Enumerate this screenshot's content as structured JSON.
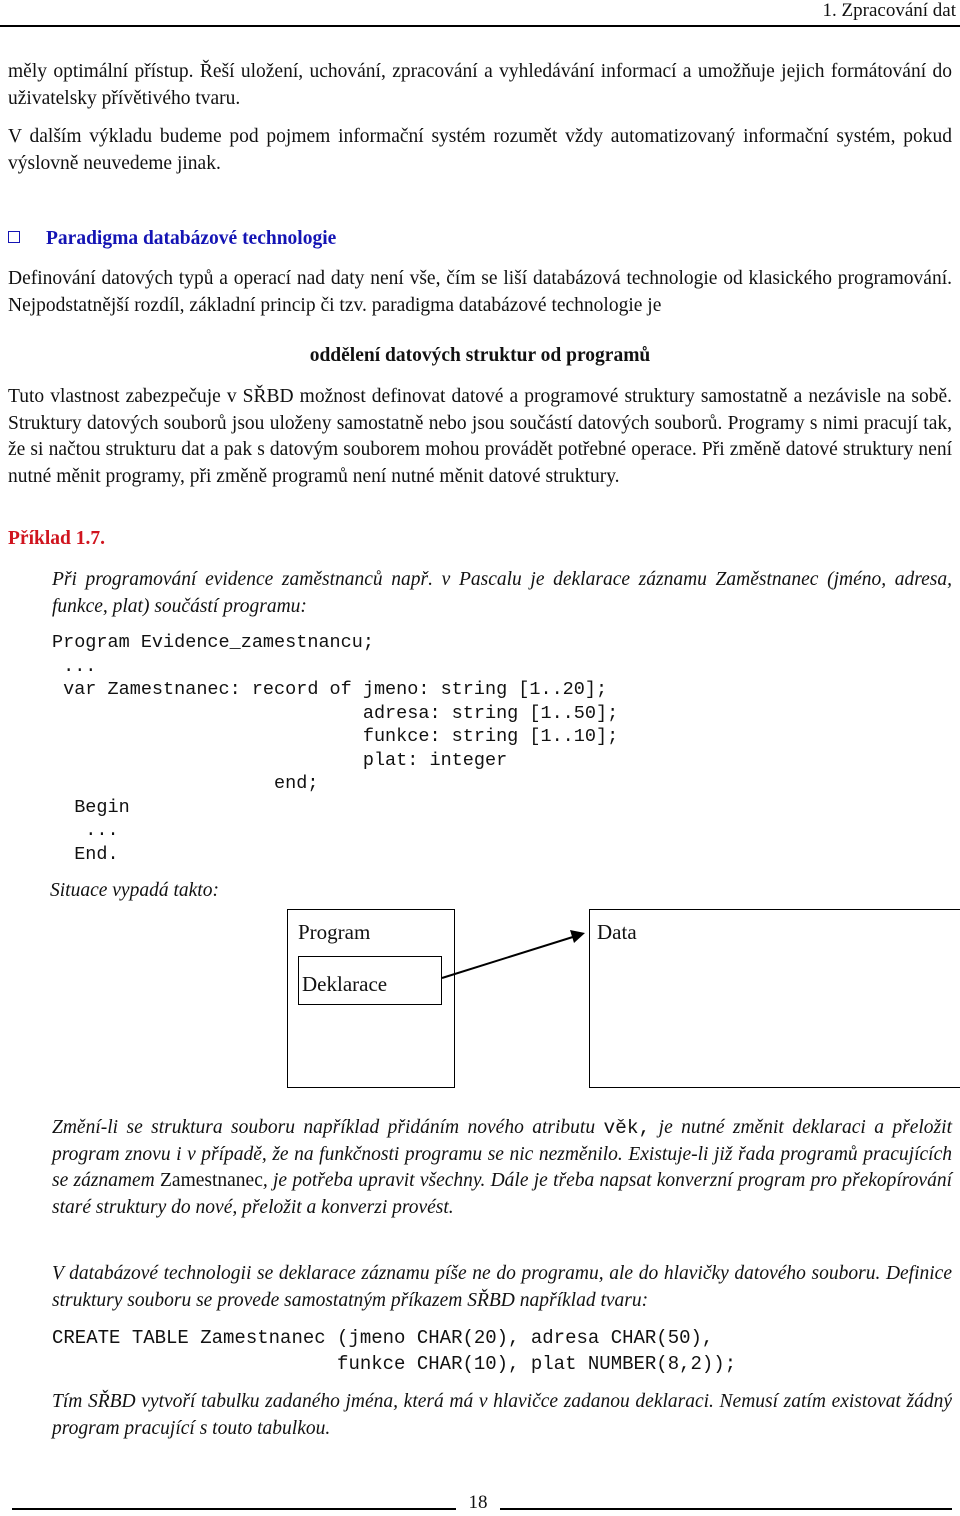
{
  "header": {
    "chapter_title": "1. Zpracování dat"
  },
  "paragraphs": {
    "p1": "měly optimální přístup. Řeší uložení, uchování, zpracování a vyhledávání informací a umožňuje jejich formátování do uživatelsky přívětivého tvaru.",
    "p2": "V dalším výkladu budeme pod pojmem informační systém rozumět vždy automatizovaný informační systém, pokud výslovně neuvedeme jinak.",
    "p3": "Definování datových typů a operací nad daty není vše, čím se liší databázová technologie od klasického programování. Nejpodstatnější rozdíl, základní princip či tzv. paradigma databázové technologie je",
    "principle": "oddělení datových struktur od programů",
    "p4": "Tuto vlastnost zabezpečuje v SŘBD možnost definovat datové a programové struktury samostatně a nezávisle na sobě. Struktury datových souborů  jsou uloženy samostatně  nebo jsou součástí datových souborů. Programy s nimi pracují tak, že si načtou strukturu dat a pak s datovým souborem mohou provádět potřebné operace. Při změně datové struktury není nutné měnit programy, při změně programů není nutné měnit datové struktury."
  },
  "section": {
    "heading": "Paradigma databázové technologie",
    "bullet_icon": "square-bullet-icon",
    "heading_color": "#1414b4"
  },
  "example": {
    "label": "Příklad 1.7.",
    "label_color": "#d0141e",
    "intro": "Při programování evidence zaměstnanců např. v Pascalu je deklarace záznamu Zaměstnanec (jméno, adresa, funkce, plat) součástí programu:",
    "pascal_code": "Program Evidence_zamestnancu;\n ...\n var Zamestnanec: record of jmeno: string [1..20];\n                            adresa: string [1..50];\n                            funkce: string [1..10];\n                            plat: integer\n                    end;\n  Begin\n   ...\n  End.",
    "situation": "Situace vypadá takto:",
    "diagram": {
      "program_label": "Program",
      "declaration_label": "Deklarace",
      "data_label": "Data"
    },
    "p6_before": "Změní-li se struktura souboru například přidáním nového atributu ",
    "p6_code": "věk,",
    "p6_mid": "  je nutné změnit deklaraci a přeložit program znovu i v případě, že na funkčnosti programu se nic nezměnilo. Existuje-li již řada programů pracujících se záznamem ",
    "p6_name": "Zamestnanec",
    "p6_after": ", je potřeba upravit všechny. Dále je třeba napsat konverzní program pro překopírování staré struktury do nové, přeložit a konverzi provést.",
    "p7": "V databázové technologii se deklarace záznamu píše ne do programu, ale do hlavičky datového souboru. Definice struktury souboru se provede samostatným příkazem SŘBD například tvaru:",
    "sql_code": "CREATE TABLE Zamestnanec (jmeno CHAR(20), adresa CHAR(50),\n                         funkce CHAR(10), plat NUMBER(8,2));",
    "p8": "Tím SŘBD vytvoří tabulku zadaného jména, která má v hlavičce zadanou deklaraci. Nemusí zatím existovat žádný program pracující s touto tabulkou."
  },
  "footer": {
    "page_number": "18"
  }
}
